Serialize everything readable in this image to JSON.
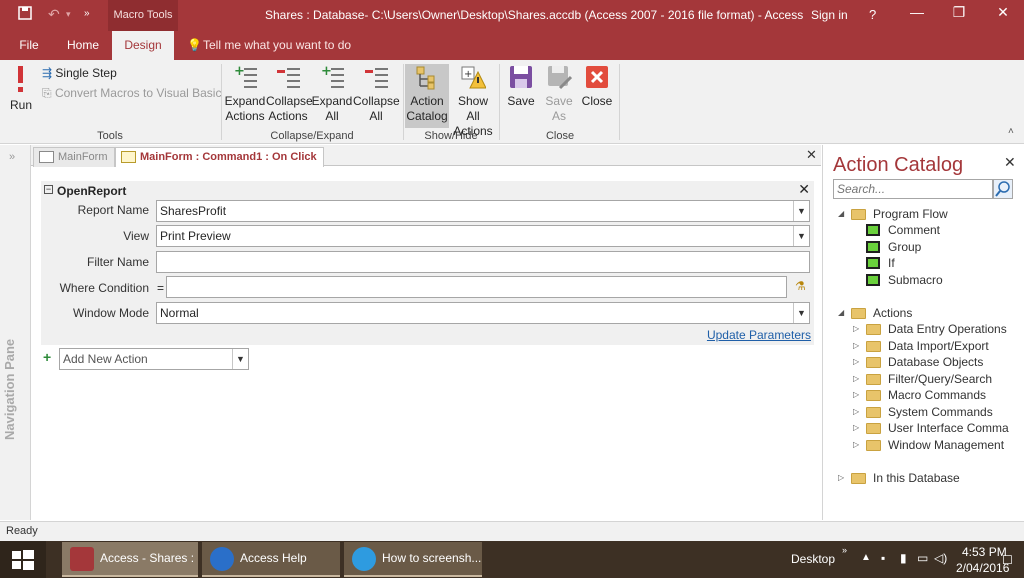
{
  "titlebar": {
    "context_tab": "Macro Tools",
    "title": "Shares : Database- C:\\Users\\Owner\\Desktop\\Shares.accdb (Access 2007 - 2016 file format) - Access",
    "signin": "Sign in",
    "help": "?",
    "minimize": "—",
    "restore": "❐",
    "close": "✕"
  },
  "tabs": {
    "file": "File",
    "home": "Home",
    "design": "Design",
    "tellme": "Tell me what you want to do"
  },
  "ribbon": {
    "run": "Run",
    "single_step": "Single Step",
    "convert": "Convert Macros to Visual Basic",
    "tools_group": "Tools",
    "expand_actions_1": "Expand",
    "expand_actions_2": "Actions",
    "collapse_actions_1": "Collapse",
    "collapse_actions_2": "Actions",
    "expand_all_1": "Expand",
    "expand_all_2": "All",
    "collapse_all_1": "Collapse",
    "collapse_all_2": "All",
    "collapse_expand_group": "Collapse/Expand",
    "action_catalog_1": "Action",
    "action_catalog_2": "Catalog",
    "show_all_1": "Show All",
    "show_all_2": "Actions",
    "show_hide_group": "Show/Hide",
    "save": "Save",
    "save_as_1": "Save",
    "save_as_2": "As",
    "close": "Close",
    "close_group": "Close"
  },
  "navpane": {
    "label": "Navigation Pane",
    "chevron": "»"
  },
  "doctabs": {
    "tab1": "MainForm",
    "tab2": "MainForm : Command1 : On Click",
    "close": "✕"
  },
  "macro": {
    "action_name": "OpenReport",
    "args": [
      {
        "label": "Report Name",
        "value": "SharesProfit"
      },
      {
        "label": "View",
        "value": "Print Preview"
      },
      {
        "label": "Filter Name",
        "value": ""
      },
      {
        "label": "Where Condition",
        "value": ""
      },
      {
        "label": "Window Mode",
        "value": "Normal"
      }
    ],
    "where_eq": "=",
    "update_parameters": "Update Parameters",
    "add_new_action": "Add New Action"
  },
  "catalog": {
    "title": "Action Catalog",
    "search_placeholder": "Search...",
    "program_flow": "Program Flow",
    "program_flow_items": [
      "Comment",
      "Group",
      "If",
      "Submacro"
    ],
    "actions": "Actions",
    "action_items": [
      "Data Entry Operations",
      "Data Import/Export",
      "Database Objects",
      "Filter/Query/Search",
      "Macro Commands",
      "System Commands",
      "User Interface Comma",
      "Window Management"
    ],
    "in_database": "In this Database"
  },
  "status": {
    "text": "Ready"
  },
  "taskbar": {
    "app1": "Access - Shares : ...",
    "app2": "Access Help",
    "app3": "How to screensh...",
    "desktop": "Desktop",
    "time": "4:53 PM",
    "date": "2/04/2016"
  },
  "colors": {
    "accent": "#a4373a",
    "ribbon_bg": "#f1f1f1"
  }
}
